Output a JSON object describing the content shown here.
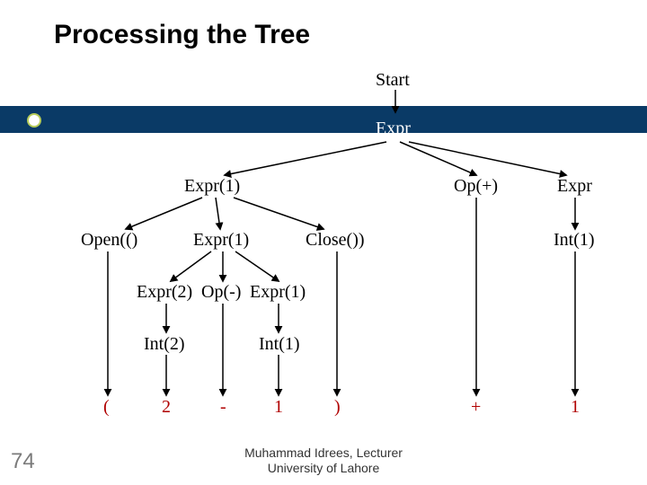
{
  "title": "Processing the Tree",
  "slide_number": "74",
  "footer_line1": "Muhammad Idrees, Lecturer",
  "footer_line2": "University of Lahore",
  "nodes": {
    "start": "Start",
    "expr_root": "Expr",
    "expr1_a": "Expr(1)",
    "op_plus": "Op(+)",
    "expr_r": "Expr",
    "open": "Open(()",
    "expr1_b": "Expr(1)",
    "close": "Close())",
    "int1_r": "Int(1)",
    "expr2": "Expr(2)",
    "op_minus": "Op(-)",
    "expr1_c": "Expr(1)",
    "int2": "Int(2)",
    "int1_l": "Int(1)"
  },
  "leaves": {
    "lparen": "(",
    "two": "2",
    "minus": "-",
    "one_a": "1",
    "rparen": ")",
    "plus": "+",
    "one_b": "1"
  },
  "colors": {
    "bar": "#0a3a66",
    "leaf": "#b00000"
  }
}
